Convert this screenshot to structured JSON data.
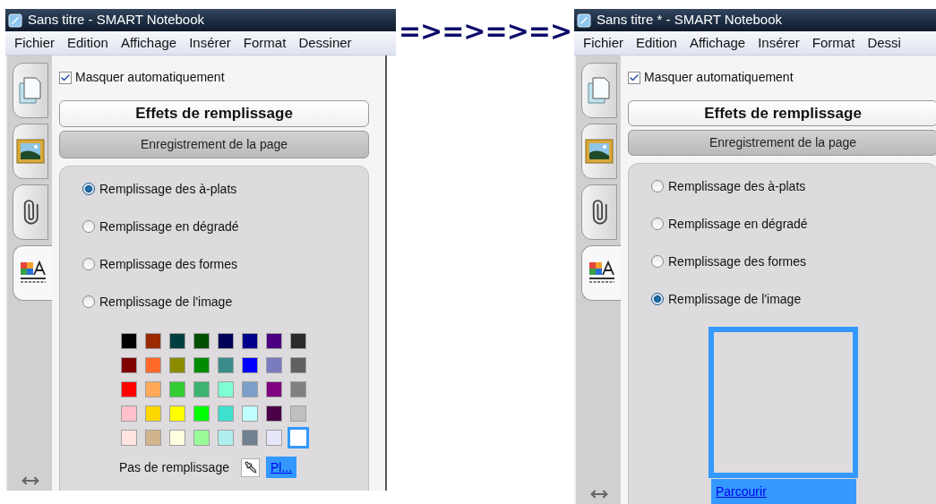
{
  "arrow": "=>=>=>=>",
  "windows": [
    {
      "title": "Sans titre - SMART Notebook",
      "menu": [
        "Fichier",
        "Edition",
        "Affichage",
        "Insérer",
        "Format",
        "Dessiner"
      ],
      "tabs": [
        {
          "kind": "pages",
          "selected": false
        },
        {
          "kind": "gallery",
          "selected": false
        },
        {
          "kind": "attachments",
          "selected": false
        },
        {
          "kind": "properties",
          "selected": true
        }
      ],
      "auto_hide": {
        "label": "Masquer automatiquement",
        "checked": true
      },
      "header": "Effets de remplissage",
      "subheader": "Enregistrement de la page",
      "fill_options": [
        {
          "label": "Remplissage des à-plats",
          "selected": true
        },
        {
          "label": "Remplissage en dégradé",
          "selected": false
        },
        {
          "label": "Remplissage des formes",
          "selected": false
        },
        {
          "label": "Remplissage de l'image",
          "selected": false
        }
      ],
      "fill_area": {
        "kind": "palette",
        "swatches": [
          {
            "color": "#000000",
            "selected": false
          },
          {
            "color": "#9b2a00",
            "selected": false
          },
          {
            "color": "#003f3f",
            "selected": false
          },
          {
            "color": "#004f00",
            "selected": false
          },
          {
            "color": "#000059",
            "selected": false
          },
          {
            "color": "#00008b",
            "selected": false
          },
          {
            "color": "#4b0082",
            "selected": false
          },
          {
            "color": "#2b2b2b",
            "selected": false
          },
          {
            "color": "#800000",
            "selected": false
          },
          {
            "color": "#ff6a28",
            "selected": false
          },
          {
            "color": "#8b8b00",
            "selected": false
          },
          {
            "color": "#008b00",
            "selected": false
          },
          {
            "color": "#3b8b8b",
            "selected": false
          },
          {
            "color": "#0000ff",
            "selected": false
          },
          {
            "color": "#7b7bc0",
            "selected": false
          },
          {
            "color": "#5f605f",
            "selected": false
          },
          {
            "color": "#ff0000",
            "selected": false
          },
          {
            "color": "#ffa858",
            "selected": false
          },
          {
            "color": "#32cd32",
            "selected": false
          },
          {
            "color": "#3cb371",
            "selected": false
          },
          {
            "color": "#7fffd4",
            "selected": false
          },
          {
            "color": "#7b9fc8",
            "selected": false
          },
          {
            "color": "#800080",
            "selected": false
          },
          {
            "color": "#808080",
            "selected": false
          },
          {
            "color": "#ffc0cb",
            "selected": false
          },
          {
            "color": "#ffd700",
            "selected": false
          },
          {
            "color": "#ffff00",
            "selected": false
          },
          {
            "color": "#00ff00",
            "selected": false
          },
          {
            "color": "#40e0d0",
            "selected": false
          },
          {
            "color": "#c0ffff",
            "selected": false
          },
          {
            "color": "#4b0048",
            "selected": false
          },
          {
            "color": "#c0c0c0",
            "selected": false
          },
          {
            "color": "#ffe4e1",
            "selected": false
          },
          {
            "color": "#d2b48c",
            "selected": false
          },
          {
            "color": "#ffffe0",
            "selected": false
          },
          {
            "color": "#98fb98",
            "selected": false
          },
          {
            "color": "#afeeee",
            "selected": false
          },
          {
            "color": "#708090",
            "selected": false
          },
          {
            "color": "#e6e6fa",
            "selected": false
          },
          {
            "color": "#ffffff",
            "selected": true
          }
        ],
        "no_fill_label": "Pas de remplissage",
        "more_link": "Pl..."
      }
    },
    {
      "title": "Sans titre * - SMART Notebook",
      "menu": [
        "Fichier",
        "Edition",
        "Affichage",
        "Insérer",
        "Format",
        "Dessi"
      ],
      "tabs": [
        {
          "kind": "pages",
          "selected": false
        },
        {
          "kind": "gallery",
          "selected": false
        },
        {
          "kind": "attachments",
          "selected": false
        },
        {
          "kind": "properties",
          "selected": true
        }
      ],
      "auto_hide": {
        "label": "Masquer automatiquement",
        "checked": true
      },
      "header": "Effets de remplissage",
      "subheader": "Enregistrement de la page",
      "fill_options": [
        {
          "label": "Remplissage des à-plats",
          "selected": false
        },
        {
          "label": "Remplissage en dégradé",
          "selected": false
        },
        {
          "label": "Remplissage des formes",
          "selected": false
        },
        {
          "label": "Remplissage de l'image",
          "selected": true
        }
      ],
      "fill_area": {
        "kind": "image",
        "browse_link": "Parcourir"
      }
    }
  ]
}
